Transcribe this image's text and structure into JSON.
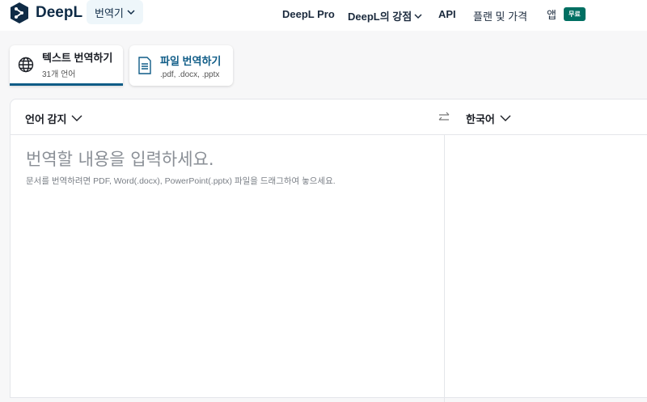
{
  "header": {
    "logo": "DeepL",
    "translator": "번역기",
    "nav": [
      "DeepL Pro",
      "DeepL의 강점",
      "API",
      "플랜 및 가격",
      "앱"
    ],
    "badge": "무료"
  },
  "tabs": [
    {
      "title": "텍스트 번역하기",
      "subtitle": "31개 언어"
    },
    {
      "title": "파일 번역하기",
      "subtitle": ".pdf, .docx, .pptx"
    }
  ],
  "translator": {
    "source_lang": "언어 감지",
    "target_lang": "한국어",
    "placeholder": "번역할 내용을 입력하세요.",
    "hint": "문서를 번역하려면 PDF, Word(.docx), PowerPoint(.pptx) 파일을 드래그하여 놓으세요."
  },
  "colors": {
    "accent": "#0f5c87",
    "badge": "#006f62",
    "logo": "#0f2b46"
  }
}
